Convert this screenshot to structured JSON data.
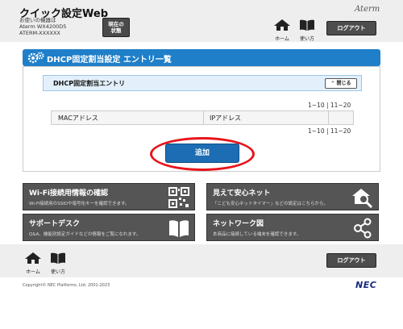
{
  "header": {
    "app_title": "クイック設定Web",
    "device_lines": [
      "お使いの機器は",
      "Aterm WX4200D5",
      "ATERM-XXXXXX"
    ],
    "status_button": [
      "現在の",
      "状態"
    ],
    "brand": "Aterm",
    "home_label": "ホーム",
    "manual_label": "使い方",
    "logout_label": "ログアウト"
  },
  "section": {
    "title": "DHCP固定割当設定 エントリ一覧",
    "panel_title": "DHCP固定割当エントリ",
    "close_label": "閉じる",
    "pager_top": "1~10 | 11~20",
    "pager_bottom": "1~10 | 11~20",
    "columns": [
      "MACアドレス",
      "IPアドレス",
      ""
    ],
    "add_label": "追加"
  },
  "annotation": {
    "ring_color": "#e8141b"
  },
  "tiles": [
    {
      "title": "Wi-Fi接続用情報の確認",
      "desc": "Wi-Fi接続用のSSIDや暗号化キーを確認できます。",
      "icon": "qr-code-icon"
    },
    {
      "title": "見えて安心ネット",
      "desc": "「こども安心ネットタイマー」などの設定はこちらから。",
      "icon": "home-search-icon"
    },
    {
      "title": "サポートデスク",
      "desc": "Q&A、機能別設定ガイドなどの情報をご覧になれます。",
      "icon": "book-icon"
    },
    {
      "title": "ネットワーク図",
      "desc": "本商品に接続している端末を確認できます。",
      "icon": "network-icon"
    }
  ],
  "footer": {
    "home_label": "ホーム",
    "manual_label": "使い方",
    "logout_label": "ログアウト",
    "copyright": "Copyright© NEC Platforms, Ltd. 2001-2023",
    "maker": "NEC"
  },
  "colors": {
    "accent": "#1f7fc9",
    "button_dark": "#4d4d4d",
    "tile": "#555555"
  }
}
